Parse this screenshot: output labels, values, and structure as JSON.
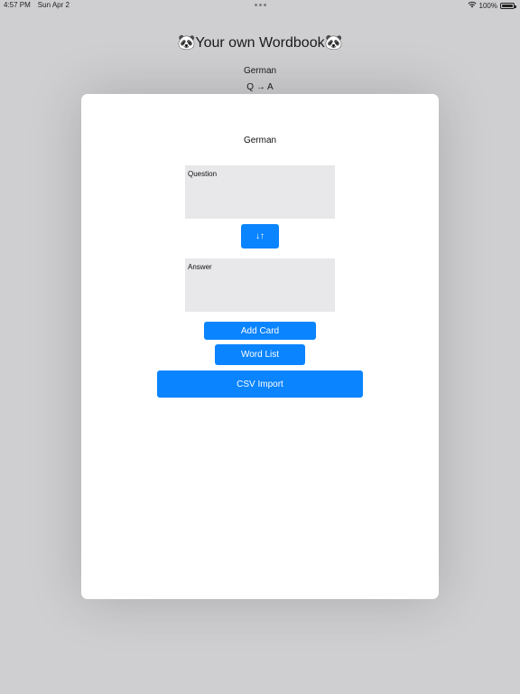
{
  "status_bar": {
    "time": "4:57 PM",
    "date": "Sun Apr 2",
    "battery_text": "100%",
    "battery_level": 1.0,
    "icons": [
      "wifi-icon",
      "battery-icon"
    ]
  },
  "background": {
    "title": "🐼Your own Wordbook🐼",
    "language": "German",
    "mode": "Q → A"
  },
  "sheet": {
    "title": "German",
    "question_placeholder": "Question",
    "swap_label": "↓↑",
    "answer_placeholder": "Answer",
    "add_card_label": "Add Card",
    "word_list_label": "Word List",
    "csv_import_label": "CSV Import"
  },
  "colors": {
    "accent": "#0a84ff",
    "dimmed_background": "#cfcfd1",
    "textbox_fill": "#e8e8ea",
    "sheet": "#ffffff"
  }
}
